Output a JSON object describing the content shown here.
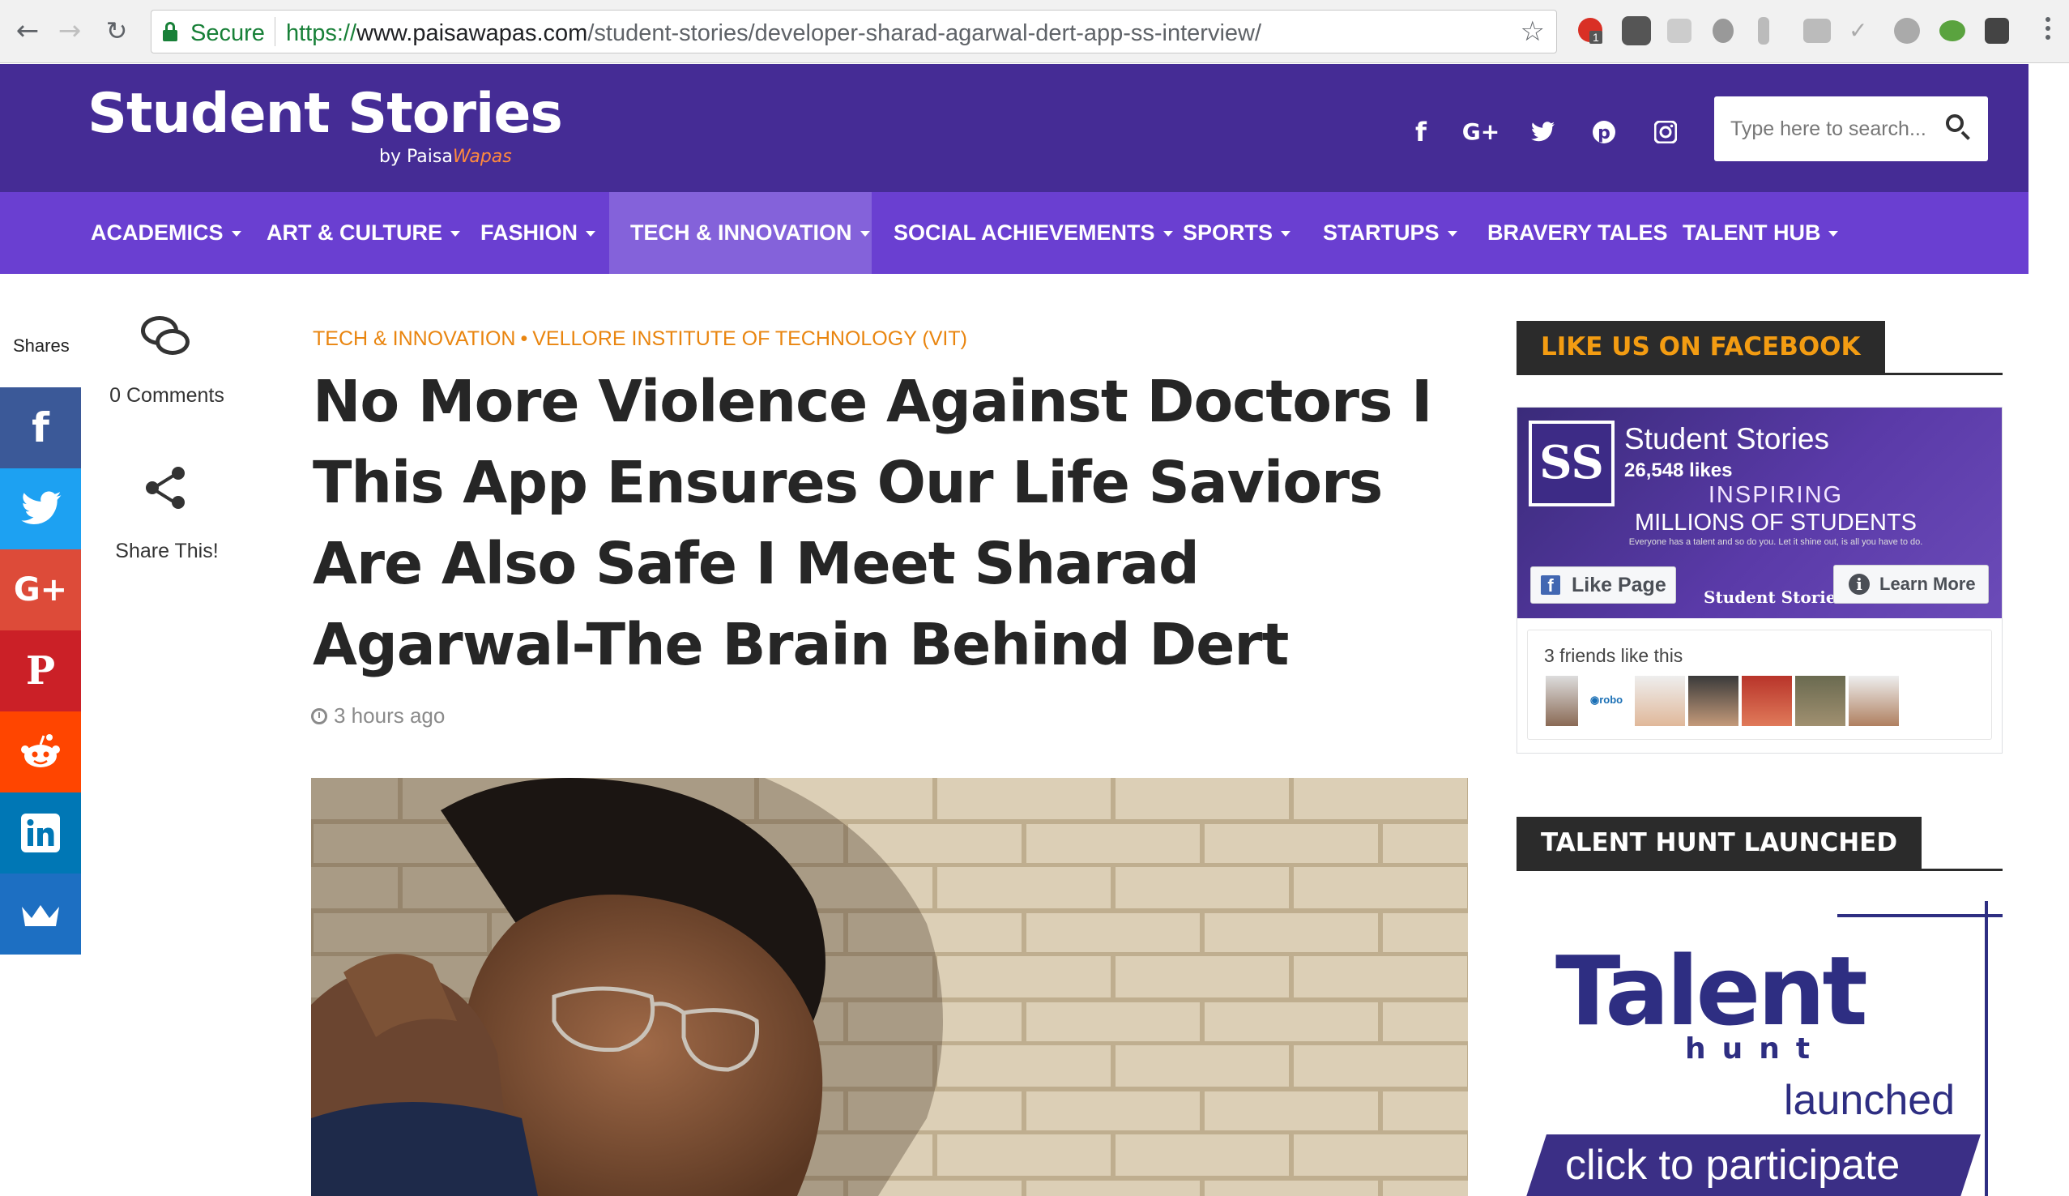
{
  "browser": {
    "secure_label": "Secure",
    "url_scheme": "https://",
    "url_host": "www.paisawapas.com",
    "url_path": "/student-stories/developer-sharad-agarwal-dert-app-ss-interview/",
    "extension_badge": "1"
  },
  "header": {
    "logo_title": "Student Stories",
    "logo_by": "by ",
    "logo_paisa": "Paisa",
    "logo_wapas": "Wapas",
    "search_placeholder": "Type here to search..."
  },
  "social_icons": [
    "facebook-icon",
    "google-plus-icon",
    "twitter-icon",
    "pinterest-icon",
    "instagram-icon"
  ],
  "nav": {
    "items": [
      {
        "label": "ACADEMICS"
      },
      {
        "label": "ART & CULTURE"
      },
      {
        "label": "FASHION"
      },
      {
        "label": "TECH & INNOVATION"
      },
      {
        "label": "SOCIAL ACHIEVEMENTS"
      },
      {
        "label": "SPORTS"
      },
      {
        "label": "STARTUPS"
      },
      {
        "label": "BRAVERY TALES"
      },
      {
        "label": "TALENT HUB"
      }
    ],
    "active": "TECH & INNOVATION"
  },
  "share_sidebar": {
    "shares_label": "Shares",
    "comments_count": "0 Comments",
    "share_this": "Share This!",
    "buttons": [
      {
        "name": "facebook",
        "glyph": "f",
        "color": "#3b5998"
      },
      {
        "name": "twitter",
        "glyph": "t",
        "color": "#1da1f2"
      },
      {
        "name": "google-plus",
        "glyph": "G+",
        "color": "#dd4b39"
      },
      {
        "name": "pinterest",
        "glyph": "P",
        "color": "#cb2027"
      },
      {
        "name": "reddit",
        "glyph": "r",
        "color": "#ff4500"
      },
      {
        "name": "linkedin",
        "glyph": "in",
        "color": "#0077b5"
      },
      {
        "name": "sumo",
        "glyph": "♛",
        "color": "#1d6fc2"
      }
    ]
  },
  "article": {
    "category": "TECH & INNOVATION",
    "separator": "•",
    "subcategory": "VELLORE INSTITUTE OF TECHNOLOGY (VIT)",
    "title": "No More Violence Against Doctors I This App Ensures Our Life Saviors Are Also Safe I Meet Sharad Agarwal-The Brain Behind Dert",
    "time": "3 hours ago"
  },
  "sidebar": {
    "facebook_widget": {
      "heading": "LIKE US ON FACEBOOK",
      "logo_text": "SS",
      "page_name": "Student Stories",
      "likes": "26,548 likes",
      "tagline1": "INSPIRING",
      "tagline2": "MILLIONS OF STUDENTS",
      "tagline3": "Everyone has a talent and so do you. Let it shine out, is all you have to do.",
      "like_button": "Like Page",
      "cover_page_name": "Student Stories",
      "learn_button": "Learn More",
      "friends_text": "3 friends like this"
    },
    "talent_widget": {
      "heading": "TALENT HUNT LAUNCHED",
      "word": "Talent",
      "hunt": "hunt",
      "launched": "launched",
      "cta": "click to participate"
    },
    "colors": {
      "header_bg": "#452c95",
      "nav_bg": "#6a3fd1",
      "nav_active": "#8462da",
      "widget_heading_fb": "#f39c12",
      "widget_heading_talent": "#ffffff",
      "category": "#e9850f"
    }
  }
}
